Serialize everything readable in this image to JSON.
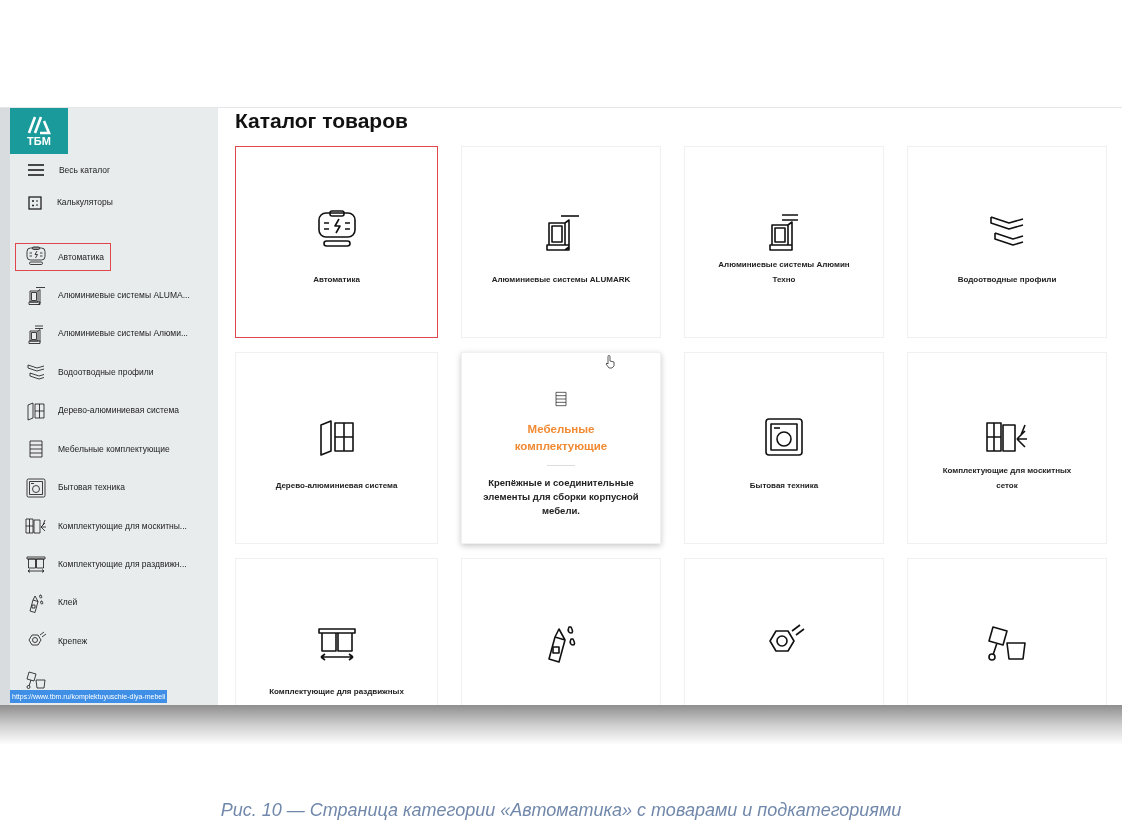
{
  "logo": {
    "text": "ТБМ"
  },
  "sidebar": {
    "top_links": [
      {
        "label": "Весь каталог",
        "kind": "menu"
      },
      {
        "label": "Калькуляторы",
        "kind": "calculator"
      }
    ],
    "categories": [
      {
        "label": "Автоматика",
        "kind": "automation",
        "highlighted": true
      },
      {
        "label": "Алюминиевые системы ALUMA...",
        "kind": "alumark",
        "highlighted": false
      },
      {
        "label": "Алюминиевые системы Алюми...",
        "kind": "techno",
        "highlighted": false
      },
      {
        "label": "Водоотводные профили",
        "kind": "profile",
        "highlighted": false
      },
      {
        "label": "Дерево-алюминиевая система",
        "kind": "wood",
        "highlighted": false
      },
      {
        "label": "Мебельные комплектующие",
        "kind": "drawers",
        "highlighted": false
      },
      {
        "label": "Бытовая техника",
        "kind": "washer",
        "highlighted": false
      },
      {
        "label": "Комплектующие для москитны...",
        "kind": "mosquito",
        "highlighted": false
      },
      {
        "label": "Комплектующие для раздвижн...",
        "kind": "sliding",
        "highlighted": false
      },
      {
        "label": "Клей",
        "kind": "glue",
        "highlighted": false
      },
      {
        "label": "Крепеж",
        "kind": "nut",
        "highlighted": false
      },
      {
        "kind": "paint",
        "highlighted": false
      }
    ],
    "status_url": "https://www.tbm.ru/komplektuyuschie-dlya-mebeli"
  },
  "catalog": {
    "title": "Каталог товаров",
    "cards": [
      {
        "title": "Автоматика",
        "kind": "automation",
        "highlighted": true,
        "hovered": false
      },
      {
        "title": "Алюминиевые системы ALUMARK",
        "kind": "alumark",
        "highlighted": false,
        "hovered": false
      },
      {
        "title": "Алюминиевые системы Алюмин Техно",
        "kind": "techno",
        "highlighted": false,
        "hovered": false
      },
      {
        "title": "Водоотводные профили",
        "kind": "profile",
        "highlighted": false,
        "hovered": false
      },
      {
        "title": "Дерево-алюминиевая система",
        "kind": "wood",
        "highlighted": false,
        "hovered": false
      },
      {
        "title": "Мебельные комплектующие",
        "description": "Крепёжные и соединительные элементы для сборки корпусной мебели.",
        "kind": "drawers",
        "highlighted": false,
        "hovered": true
      },
      {
        "title": "Бытовая техника",
        "kind": "washer",
        "highlighted": false,
        "hovered": false
      },
      {
        "title": "Комплектующие для москитных сеток",
        "kind": "mosquito",
        "highlighted": false,
        "hovered": false
      },
      {
        "title": "Комплектующие для раздвижных",
        "kind": "sliding",
        "highlighted": false,
        "hovered": false
      },
      {
        "kind": "glue",
        "highlighted": false,
        "hovered": false
      },
      {
        "kind": "nut",
        "highlighted": false,
        "hovered": false
      },
      {
        "kind": "paint",
        "highlighted": false,
        "hovered": false
      }
    ]
  },
  "caption": "Рис. 10 — Страница категории «Автоматика» с товарами и подкатегориями"
}
